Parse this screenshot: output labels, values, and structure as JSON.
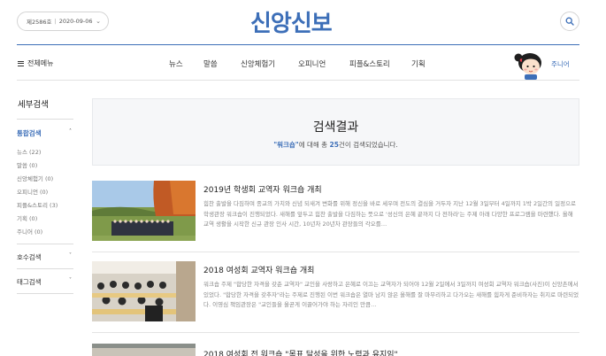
{
  "header": {
    "issue_number": "제2586호",
    "issue_date": "2020-09-06",
    "logo": "신앙신보",
    "search_icon": "search-icon"
  },
  "nav": {
    "all_menu": "전체메뉴",
    "items": [
      "뉴스",
      "말씀",
      "신앙체험기",
      "오피니언",
      "피플&스토리",
      "기획"
    ],
    "junior": "주니어"
  },
  "sidebar": {
    "title": "세부검색",
    "integrated": "통합검색",
    "items": [
      "뉴스 (22)",
      "말씀 (0)",
      "신앙체험기 (0)",
      "오피니언 (0)",
      "피플&스토리 (3)",
      "기획 (0)",
      "주니어 (0)"
    ],
    "issue_search": "호수검색",
    "tag_search": "태그검색"
  },
  "results": {
    "title": "검색결과",
    "query": "\"워크숍\"",
    "pre_count": "에 대해 총",
    "count": "25",
    "post_count": "건이 검색되었습니다."
  },
  "articles": [
    {
      "title": "2019년 학생회 교역자 워크숍 개최",
      "body": "힘찬 출발을 다짐하며 종교의 가치와 신념 되새겨 변화를 위해 정신을 바로 세우며 전도의 결심을 거두자 지난 12월 3일부터 4일까지 1박 2일간의 일정으로 학생관장 워크숍이 진행되었다. 새해를 앞두고 힘찬 출발을 다짐하는 뜻으로 '성신의 은혜 끝까지 다 전하라'는 주제 아래 다양한 프로그램을 마련했다. 올해 교역 생활을 시작한 신규 관장 인사 시간, 10년차 20년차 관장들의 각오를…"
    },
    {
      "title": "2018 여성회 교역자 워크숍 개최",
      "body": "워크숍 주제 \"합당한 자격을 갖춘 교역자\" 교인을 사랑하고 은혜로 이끄는 교역자가 되어야 12월 2일에서 3일까지 여성회 교역자 워크숍(사진)이 신앙촌에서 있었다. \"합당한 자격을 갖추자\"라는 주제로 진행된 이번 워크숍은 열마 남지 않은 올해를 잘 마무리하고 다가오는 새해를 힘차게 준비하자는 취지로 마련되었다. 이영심 책임관장은 \"교인들을 올곧게 이끌어가야 하는 자리인 만큼…"
    },
    {
      "title": "2018 여성회 전 워크숍 \"목표 달성을 위한 노력과 유지임\""
    }
  ]
}
